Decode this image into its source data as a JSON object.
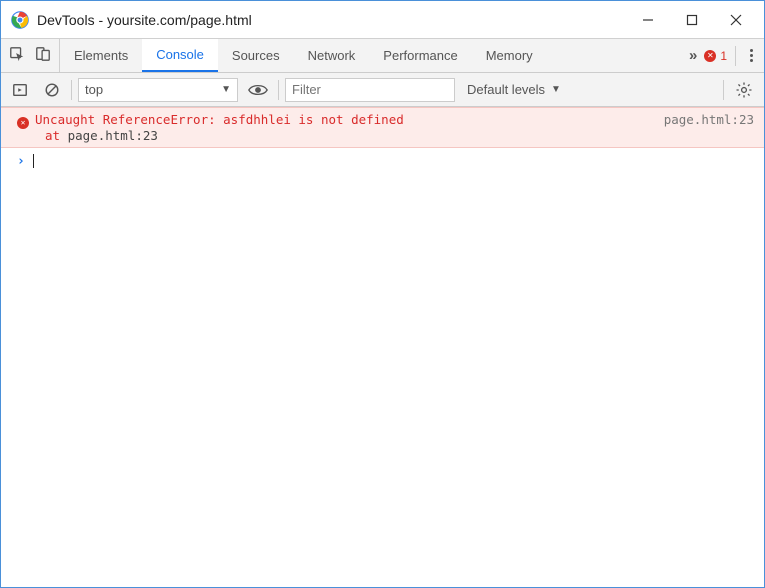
{
  "window": {
    "title": "DevTools - yoursite.com/page.html"
  },
  "tabs": {
    "items": [
      "Elements",
      "Console",
      "Sources",
      "Network",
      "Performance",
      "Memory"
    ],
    "active": "Console",
    "error_badge_count": "1"
  },
  "console_toolbar": {
    "context": "top",
    "filter_placeholder": "Filter",
    "levels_label": "Default levels"
  },
  "error": {
    "message": "Uncaught ReferenceError: asfdhhlei is not defined",
    "at_label": "at",
    "at_location": "page.html:23",
    "source": "page.html:23"
  }
}
